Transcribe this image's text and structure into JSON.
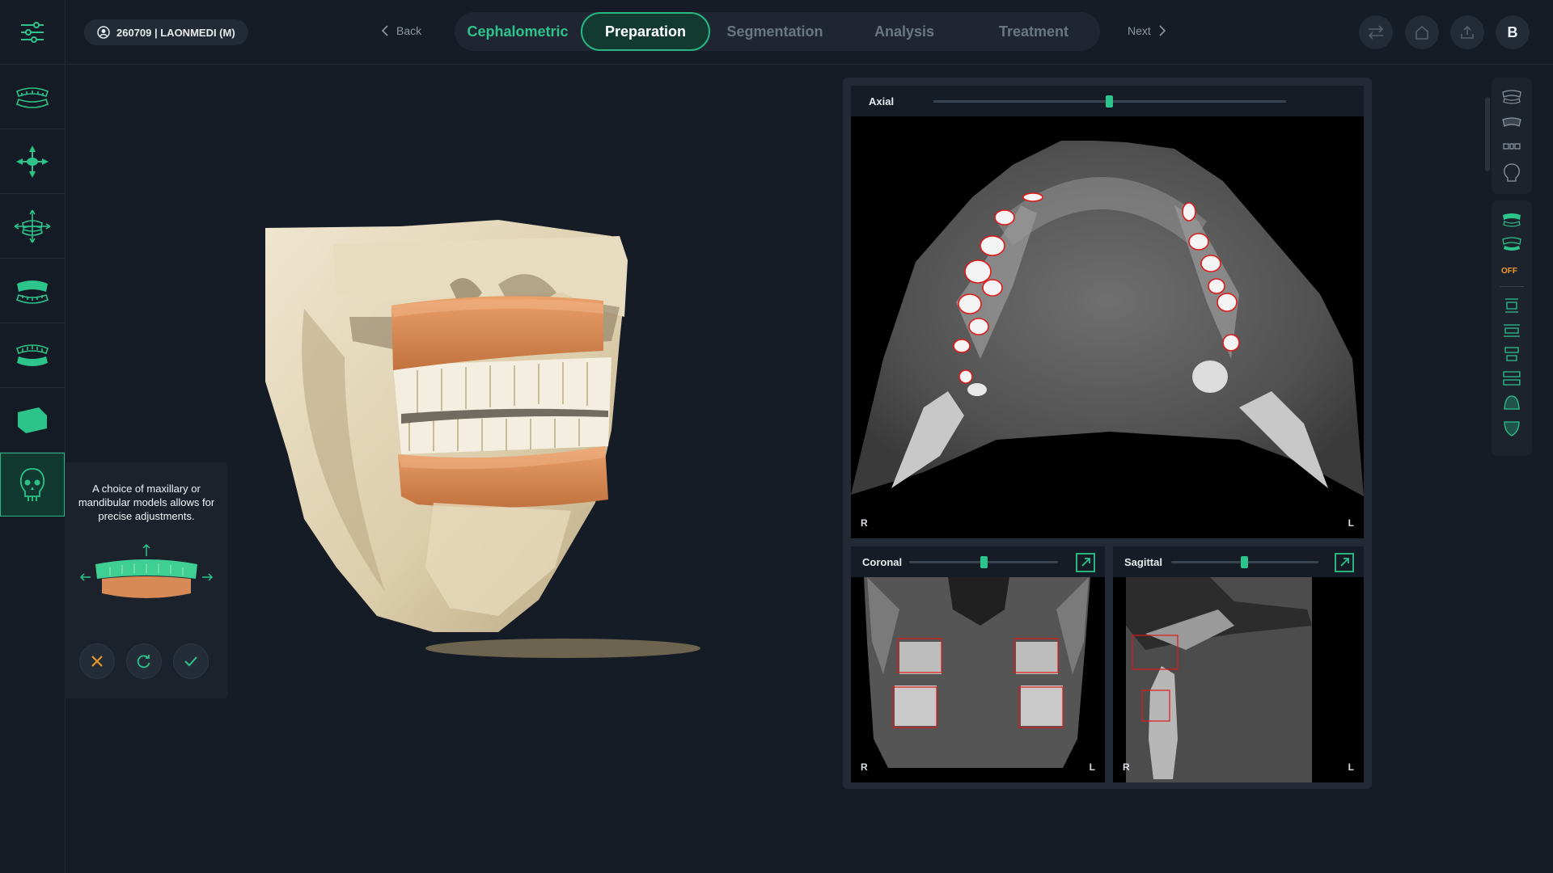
{
  "header": {
    "patient_label": "260709 | LAONMEDI (M)",
    "back_label": "Back",
    "next_label": "Next",
    "user_initial": "B",
    "tabs": [
      {
        "label": "Cephalometric",
        "state": "done"
      },
      {
        "label": "Preparation",
        "state": "active"
      },
      {
        "label": "Segmentation",
        "state": "inactive"
      },
      {
        "label": "Analysis",
        "state": "inactive"
      },
      {
        "label": "Treatment",
        "state": "inactive"
      }
    ],
    "tool_icons": [
      "swap-arrows-icon",
      "home-icon",
      "upload-icon"
    ]
  },
  "sidebar": {
    "items": [
      {
        "name": "arch-model-tool",
        "icon": "dental-arch-icon"
      },
      {
        "name": "move-tool",
        "icon": "four-way-move-icon"
      },
      {
        "name": "orientation-tool",
        "icon": "axis-orientation-icon"
      },
      {
        "name": "maxillary-model-tool",
        "icon": "upper-teeth-icon"
      },
      {
        "name": "mandibular-model-tool",
        "icon": "lower-teeth-icon"
      },
      {
        "name": "crop-tool",
        "icon": "crop-shape-icon"
      },
      {
        "name": "skull-tool",
        "icon": "skull-icon",
        "active": true
      }
    ]
  },
  "popover": {
    "text": "A choice of maxillary or mandibular models allows for precise adjustments.",
    "buttons": [
      "cancel",
      "reset",
      "confirm"
    ]
  },
  "views": {
    "axial": {
      "label": "Axial",
      "slider": 0.5,
      "left_marker": "R",
      "right_marker": "L"
    },
    "coronal": {
      "label": "Coronal",
      "slider": 0.5,
      "left_marker": "R",
      "right_marker": "L"
    },
    "sagittal": {
      "label": "Sagittal",
      "slider": 0.5,
      "left_marker": "R",
      "right_marker": "L"
    }
  },
  "right_toolbar": {
    "off_label": "OFF"
  },
  "colors": {
    "accent": "#27b582",
    "model_orange": "#d78a55",
    "bone": "#ddd0b2",
    "segmentation_red": "#e02020",
    "off_orange": "#f09a28"
  }
}
